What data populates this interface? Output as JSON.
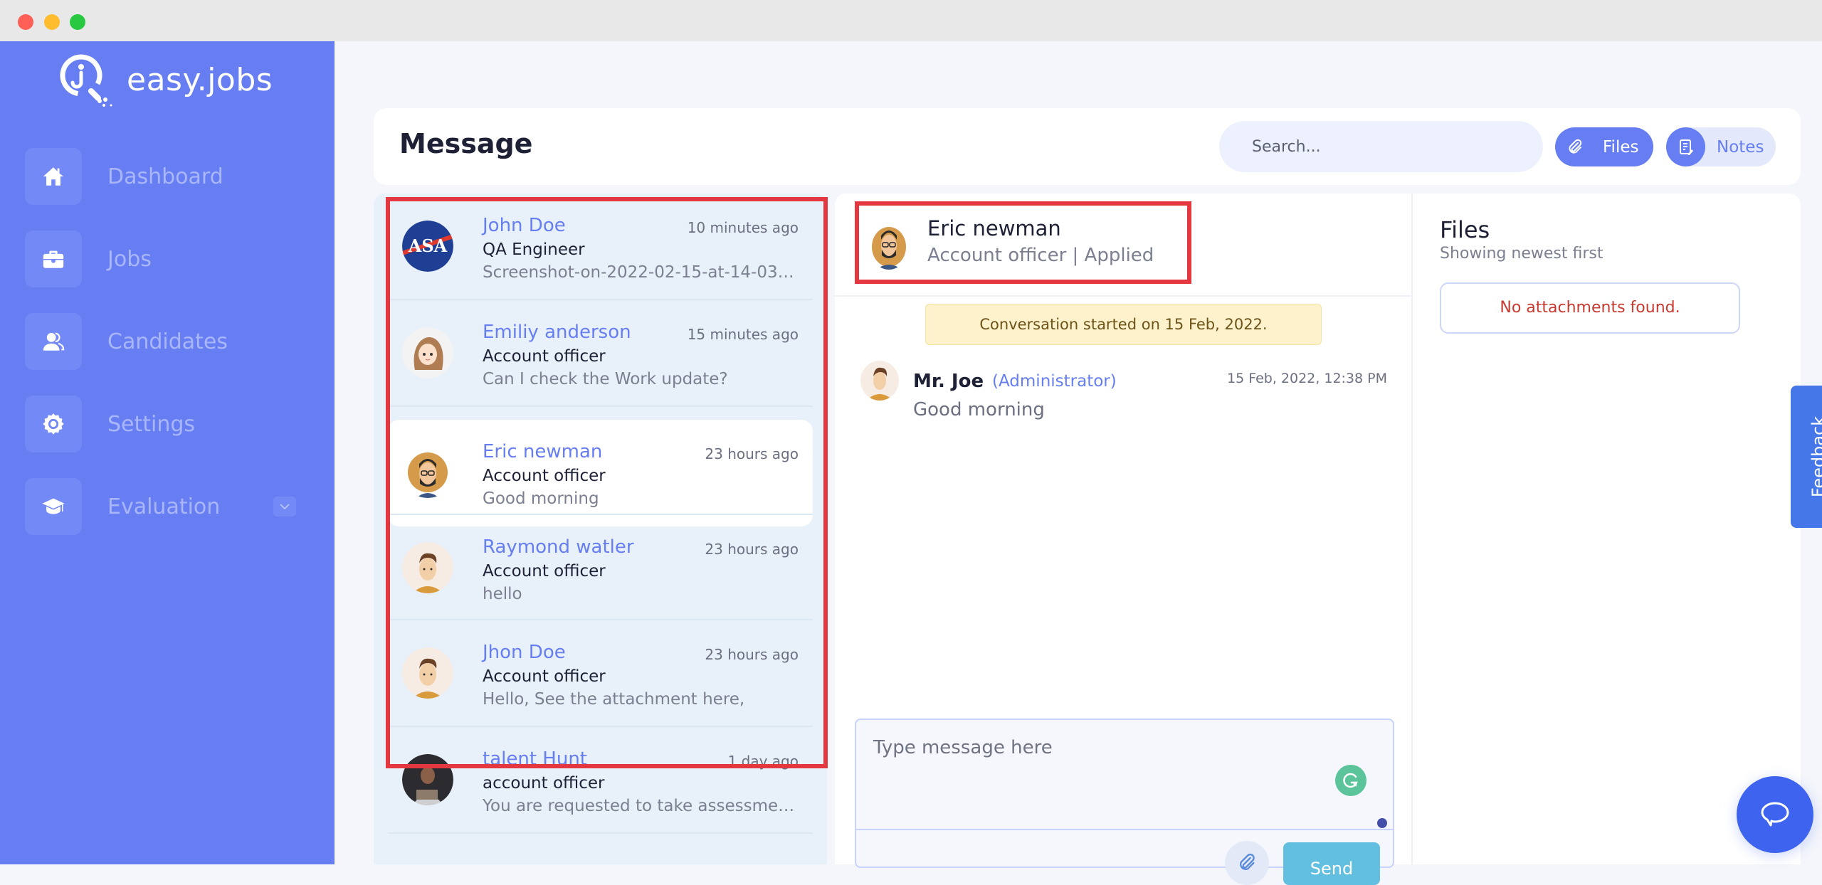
{
  "window": {
    "controls": [
      "close",
      "minimize",
      "maximize"
    ]
  },
  "brand": {
    "name": "easy.jobs",
    "icon": "easyjobs-logo-icon"
  },
  "sidebar": {
    "items": [
      {
        "label": "Dashboard",
        "icon": "home-icon"
      },
      {
        "label": "Jobs",
        "icon": "briefcase-icon"
      },
      {
        "label": "Candidates",
        "icon": "users-icon"
      },
      {
        "label": "Settings",
        "icon": "gear-icon"
      },
      {
        "label": "Evaluation",
        "icon": "graduation-cap-icon",
        "has_submenu": true
      }
    ]
  },
  "header": {
    "title": "Message",
    "search_placeholder": "Search...",
    "files_label": "Files",
    "notes_label": "Notes"
  },
  "conversations": [
    {
      "name": "John Doe",
      "time": "10 minutes ago",
      "role": "QA Engineer",
      "preview": "Screenshot-on-2022-02-15-at-14-03-2...",
      "avatar": "nasa-logo",
      "active": false
    },
    {
      "name": "Emiliy anderson",
      "time": "15 minutes ago",
      "role": "Account officer",
      "preview": "Can I check the Work update?",
      "avatar": "woman-illustration",
      "active": false
    },
    {
      "name": "Eric newman",
      "time": "23 hours ago",
      "role": "Account officer",
      "preview": "Good morning",
      "avatar": "bearded-man-glasses",
      "active": true
    },
    {
      "name": "Raymond watler",
      "time": "23 hours ago",
      "role": "Account officer",
      "preview": "hello",
      "avatar": "man-illustration",
      "active": false
    },
    {
      "name": "Jhon Doe",
      "time": "23 hours ago",
      "role": "Account officer",
      "preview": "Hello, See the attachment here,",
      "avatar": "man-illustration",
      "active": false
    },
    {
      "name": "talent Hunt",
      "time": "1 day ago",
      "role": "account officer",
      "preview": "You are requested to take assessmen...",
      "avatar": "photo-man-laptop",
      "active": false
    }
  ],
  "chat": {
    "contact_name": "Eric newman",
    "contact_subtitle": "Account officer | Applied",
    "banner": "Conversation started on 15 Feb, 2022.",
    "messages": [
      {
        "author": "Mr. Joe",
        "role": "(Administrator)",
        "timestamp": "15 Feb, 2022, 12:38 PM",
        "text": "Good morning"
      }
    ],
    "composer_placeholder": "Type message here",
    "send_label": "Send"
  },
  "files_panel": {
    "title": "Files",
    "subtitle": "Showing newest first",
    "empty_text": "No attachments found."
  },
  "feedback_label": "Feedback",
  "colors": {
    "sidebar": "#667ef2",
    "accent": "#667ef2",
    "highlight": "#e5373f",
    "error": "#c8392f",
    "send": "#62bfe0",
    "banner": "#fdf2cc"
  }
}
